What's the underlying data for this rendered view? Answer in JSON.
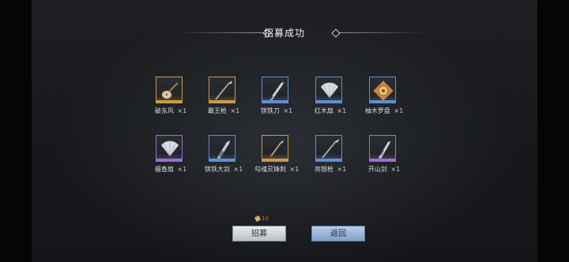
{
  "title": "招募成功",
  "colors": {
    "gold": "#c99a4a",
    "blue": "#5f8fd0",
    "purple": "#9a6fd0",
    "cost": "#e25a3a"
  },
  "items": [
    {
      "name": "破东风",
      "qty": "×1",
      "rarity": "gold",
      "icon": "pipa-icon"
    },
    {
      "name": "霸王枪",
      "qty": "×1",
      "rarity": "gold",
      "icon": "spear-icon"
    },
    {
      "name": "镔铁刀",
      "qty": "×1",
      "rarity": "blue",
      "icon": "blade-icon"
    },
    {
      "name": "红木扇",
      "qty": "×1",
      "rarity": "blue",
      "icon": "fan-icon"
    },
    {
      "name": "柚木罗盘",
      "qty": "×1",
      "rarity": "blue",
      "icon": "compass-icon"
    },
    {
      "name": "檀香扇",
      "qty": "×1",
      "rarity": "purple",
      "icon": "fan-icon"
    },
    {
      "name": "镔铁大剑",
      "qty": "×1",
      "rarity": "blue",
      "icon": "greatsword-icon"
    },
    {
      "name": "勾魂灵锋刺",
      "qty": "×1",
      "rarity": "gold",
      "icon": "dagger-icon"
    },
    {
      "name": "亮银枪",
      "qty": "×1",
      "rarity": "blue",
      "icon": "spear-icon"
    },
    {
      "name": "开山剑",
      "qty": "×1",
      "rarity": "purple",
      "icon": "sword-icon"
    }
  ],
  "cost": {
    "icon": "scroll-icon",
    "amount": "10"
  },
  "buttons": {
    "recruit": "招募",
    "back": "返回"
  }
}
